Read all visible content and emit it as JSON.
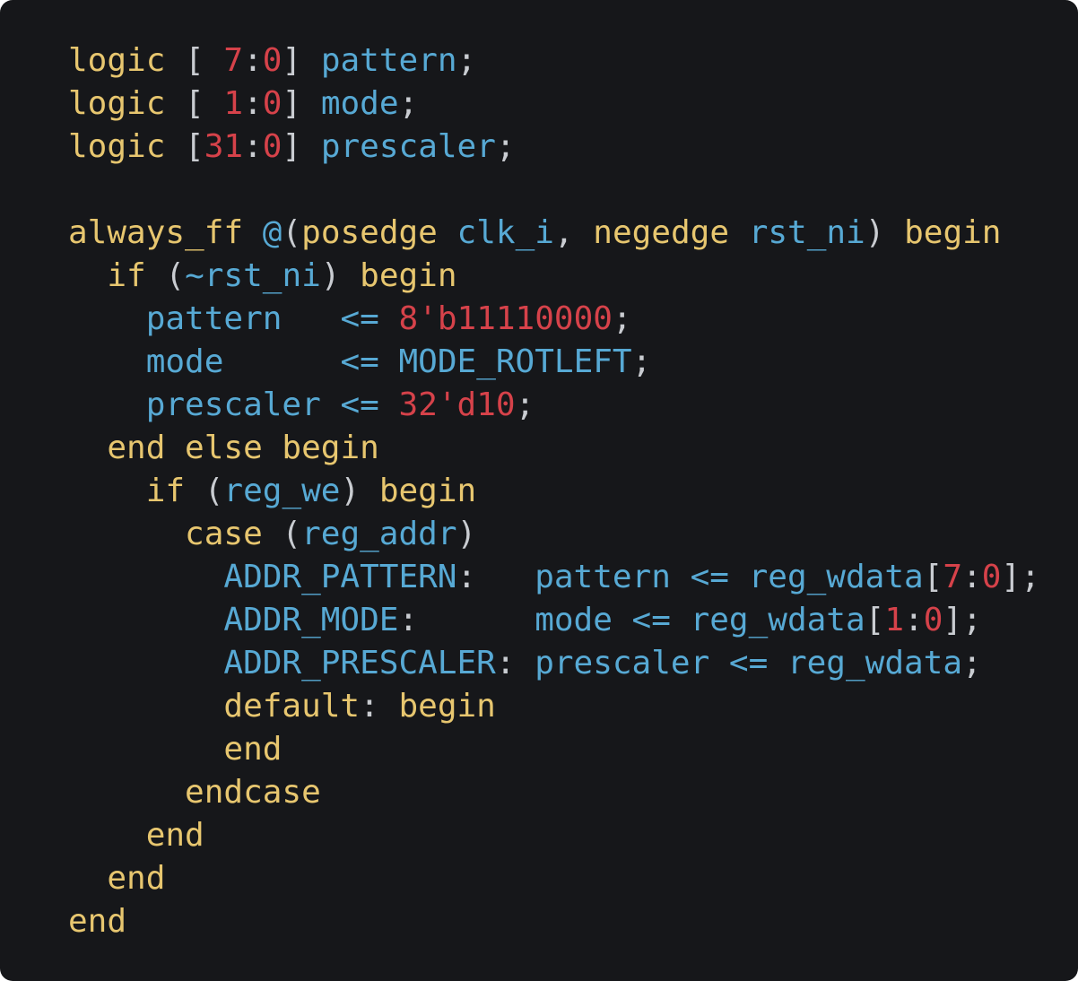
{
  "editor": {
    "language": "SystemVerilog",
    "colors": {
      "background": "#16171a",
      "keyword": "#e7c66f",
      "identifier": "#57a9d4",
      "number": "#d6424a",
      "punctuation": "#c9ccd1"
    },
    "lines": [
      [
        {
          "t": "logic",
          "c": "kw"
        },
        {
          "t": " [ ",
          "c": "punc"
        },
        {
          "t": "7",
          "c": "num"
        },
        {
          "t": ":",
          "c": "punc"
        },
        {
          "t": "0",
          "c": "num"
        },
        {
          "t": "] ",
          "c": "punc"
        },
        {
          "t": "pattern",
          "c": "id"
        },
        {
          "t": ";",
          "c": "punc"
        }
      ],
      [
        {
          "t": "logic",
          "c": "kw"
        },
        {
          "t": " [ ",
          "c": "punc"
        },
        {
          "t": "1",
          "c": "num"
        },
        {
          "t": ":",
          "c": "punc"
        },
        {
          "t": "0",
          "c": "num"
        },
        {
          "t": "] ",
          "c": "punc"
        },
        {
          "t": "mode",
          "c": "id"
        },
        {
          "t": ";",
          "c": "punc"
        }
      ],
      [
        {
          "t": "logic",
          "c": "kw"
        },
        {
          "t": " [",
          "c": "punc"
        },
        {
          "t": "31",
          "c": "num"
        },
        {
          "t": ":",
          "c": "punc"
        },
        {
          "t": "0",
          "c": "num"
        },
        {
          "t": "] ",
          "c": "punc"
        },
        {
          "t": "prescaler",
          "c": "id"
        },
        {
          "t": ";",
          "c": "punc"
        }
      ],
      [],
      [
        {
          "t": "always_ff",
          "c": "kw"
        },
        {
          "t": " ",
          "c": "punc"
        },
        {
          "t": "@",
          "c": "id"
        },
        {
          "t": "(",
          "c": "punc"
        },
        {
          "t": "posedge",
          "c": "kw"
        },
        {
          "t": " ",
          "c": "punc"
        },
        {
          "t": "clk_i",
          "c": "id"
        },
        {
          "t": ", ",
          "c": "punc"
        },
        {
          "t": "negedge",
          "c": "kw"
        },
        {
          "t": " ",
          "c": "punc"
        },
        {
          "t": "rst_ni",
          "c": "id"
        },
        {
          "t": ") ",
          "c": "punc"
        },
        {
          "t": "begin",
          "c": "kw"
        }
      ],
      [
        {
          "t": "  ",
          "c": "punc"
        },
        {
          "t": "if",
          "c": "kw"
        },
        {
          "t": " (",
          "c": "punc"
        },
        {
          "t": "~rst_ni",
          "c": "id"
        },
        {
          "t": ") ",
          "c": "punc"
        },
        {
          "t": "begin",
          "c": "kw"
        }
      ],
      [
        {
          "t": "    ",
          "c": "punc"
        },
        {
          "t": "pattern",
          "c": "id"
        },
        {
          "t": "   ",
          "c": "punc"
        },
        {
          "t": "<=",
          "c": "id"
        },
        {
          "t": " ",
          "c": "punc"
        },
        {
          "t": "8'b11110000",
          "c": "num"
        },
        {
          "t": ";",
          "c": "punc"
        }
      ],
      [
        {
          "t": "    ",
          "c": "punc"
        },
        {
          "t": "mode",
          "c": "id"
        },
        {
          "t": "      ",
          "c": "punc"
        },
        {
          "t": "<=",
          "c": "id"
        },
        {
          "t": " ",
          "c": "punc"
        },
        {
          "t": "MODE_ROTLEFT",
          "c": "id"
        },
        {
          "t": ";",
          "c": "punc"
        }
      ],
      [
        {
          "t": "    ",
          "c": "punc"
        },
        {
          "t": "prescaler",
          "c": "id"
        },
        {
          "t": " ",
          "c": "punc"
        },
        {
          "t": "<=",
          "c": "id"
        },
        {
          "t": " ",
          "c": "punc"
        },
        {
          "t": "32'd10",
          "c": "num"
        },
        {
          "t": ";",
          "c": "punc"
        }
      ],
      [
        {
          "t": "  ",
          "c": "punc"
        },
        {
          "t": "end else begin",
          "c": "kw"
        }
      ],
      [
        {
          "t": "    ",
          "c": "punc"
        },
        {
          "t": "if",
          "c": "kw"
        },
        {
          "t": " (",
          "c": "punc"
        },
        {
          "t": "reg_we",
          "c": "id"
        },
        {
          "t": ") ",
          "c": "punc"
        },
        {
          "t": "begin",
          "c": "kw"
        }
      ],
      [
        {
          "t": "      ",
          "c": "punc"
        },
        {
          "t": "case",
          "c": "kw"
        },
        {
          "t": " (",
          "c": "punc"
        },
        {
          "t": "reg_addr",
          "c": "id"
        },
        {
          "t": ")",
          "c": "punc"
        }
      ],
      [
        {
          "t": "        ",
          "c": "punc"
        },
        {
          "t": "ADDR_PATTERN",
          "c": "id"
        },
        {
          "t": ":   ",
          "c": "punc"
        },
        {
          "t": "pattern <= reg_wdata",
          "c": "id"
        },
        {
          "t": "[",
          "c": "punc"
        },
        {
          "t": "7",
          "c": "num"
        },
        {
          "t": ":",
          "c": "punc"
        },
        {
          "t": "0",
          "c": "num"
        },
        {
          "t": "];",
          "c": "punc"
        }
      ],
      [
        {
          "t": "        ",
          "c": "punc"
        },
        {
          "t": "ADDR_MODE",
          "c": "id"
        },
        {
          "t": ":      ",
          "c": "punc"
        },
        {
          "t": "mode <= reg_wdata",
          "c": "id"
        },
        {
          "t": "[",
          "c": "punc"
        },
        {
          "t": "1",
          "c": "num"
        },
        {
          "t": ":",
          "c": "punc"
        },
        {
          "t": "0",
          "c": "num"
        },
        {
          "t": "];",
          "c": "punc"
        }
      ],
      [
        {
          "t": "        ",
          "c": "punc"
        },
        {
          "t": "ADDR_PRESCALER",
          "c": "id"
        },
        {
          "t": ": ",
          "c": "punc"
        },
        {
          "t": "prescaler <= reg_wdata",
          "c": "id"
        },
        {
          "t": ";",
          "c": "punc"
        }
      ],
      [
        {
          "t": "        ",
          "c": "punc"
        },
        {
          "t": "default",
          "c": "kw"
        },
        {
          "t": ": ",
          "c": "punc"
        },
        {
          "t": "begin",
          "c": "kw"
        }
      ],
      [
        {
          "t": "        ",
          "c": "punc"
        },
        {
          "t": "end",
          "c": "kw"
        }
      ],
      [
        {
          "t": "      ",
          "c": "punc"
        },
        {
          "t": "endcase",
          "c": "kw"
        }
      ],
      [
        {
          "t": "    ",
          "c": "punc"
        },
        {
          "t": "end",
          "c": "kw"
        }
      ],
      [
        {
          "t": "  ",
          "c": "punc"
        },
        {
          "t": "end",
          "c": "kw"
        }
      ],
      [
        {
          "t": "end",
          "c": "kw"
        }
      ]
    ]
  }
}
